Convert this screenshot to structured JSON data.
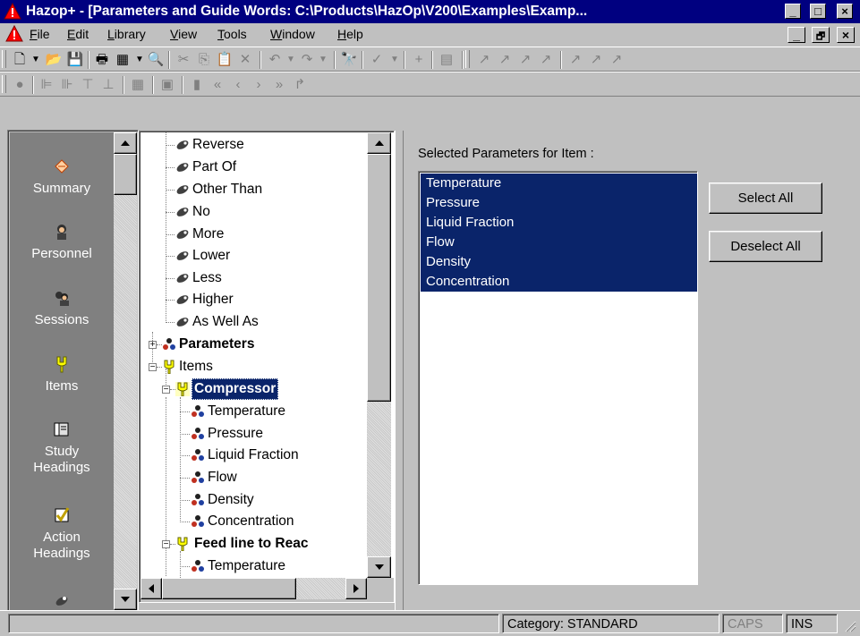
{
  "window": {
    "title": "Hazop+ - [Parameters and Guide Words: C:\\Products\\HazOp\\V200\\Examples\\Examp...",
    "min_glyph": "_",
    "max_glyph": "□",
    "close_glyph": "×"
  },
  "menu": {
    "items": [
      {
        "accel": "F",
        "rest": "ile"
      },
      {
        "accel": "E",
        "rest": "dit"
      },
      {
        "accel": "L",
        "rest": "ibrary"
      },
      {
        "accel": "V",
        "rest": "iew"
      },
      {
        "accel": "T",
        "rest": "ools"
      },
      {
        "accel": "W",
        "rest": "indow"
      },
      {
        "accel": "H",
        "rest": "elp"
      }
    ],
    "mdi_min": "_",
    "mdi_restore": "🗗",
    "mdi_close": "×"
  },
  "sidebar": {
    "items": [
      {
        "label": "Summary",
        "icon": "summary-icon"
      },
      {
        "label": "Personnel",
        "icon": "personnel-icon"
      },
      {
        "label": "Sessions",
        "icon": "sessions-icon"
      },
      {
        "label": "Items",
        "icon": "items-icon"
      },
      {
        "label": "Study Headings",
        "icon": "study-headings-icon"
      },
      {
        "label": "Action Headings",
        "icon": "action-headings-icon"
      }
    ]
  },
  "tree": {
    "guide_words": [
      "Reverse",
      "Part Of",
      "Other Than",
      "No",
      "More",
      "Lower",
      "Less",
      "Higher",
      "As Well As"
    ],
    "parameters_label": "Parameters",
    "items_label": "Items",
    "compressor_label": "Compressor",
    "compressor_params": [
      "Temperature",
      "Pressure",
      "Liquid Fraction",
      "Flow",
      "Density",
      "Concentration"
    ],
    "feed_line_label": "Feed line to Reac",
    "feed_line_params": [
      "Temperature"
    ]
  },
  "panel": {
    "selected_label": "Selected Parameters for Item :",
    "selected_params": [
      "Temperature",
      "Pressure",
      "Liquid Fraction",
      "Flow",
      "Density",
      "Concentration"
    ],
    "select_all": "Select All",
    "deselect_all": "Deselect All"
  },
  "status": {
    "category": "Category: STANDARD",
    "caps": "CAPS",
    "ins": "INS"
  },
  "colors": {
    "titlebar": "#000080",
    "selection": "#0a246a",
    "appbar": "#808080"
  }
}
